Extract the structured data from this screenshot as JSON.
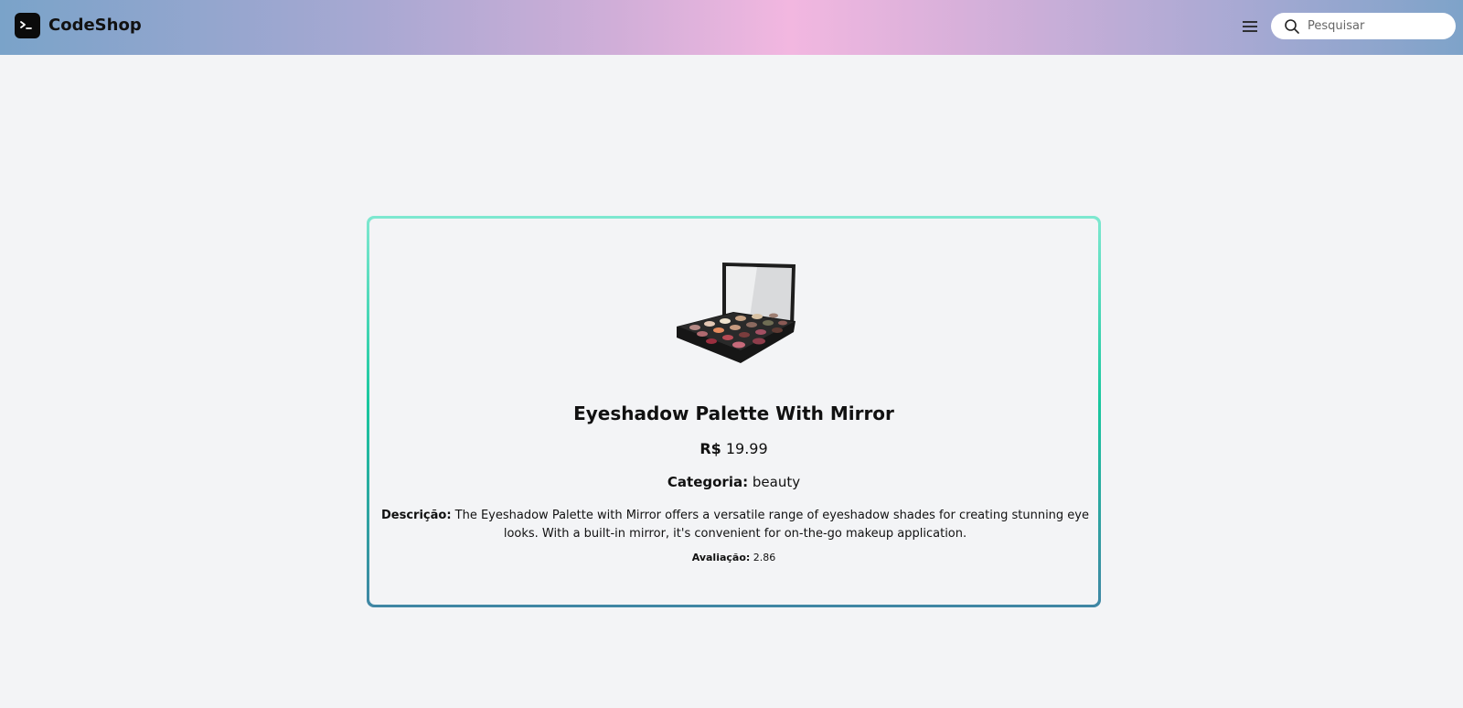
{
  "header": {
    "brand": "CodeShop",
    "menu_icon": "hamburger-menu-icon",
    "logo_icon": "terminal-icon",
    "search": {
      "placeholder": "Pesquisar",
      "value": "",
      "icon": "search-icon"
    },
    "gradient_colors": [
      "#7aa3c9",
      "#f2b7e0",
      "#7ea3c9"
    ]
  },
  "product": {
    "title": "Eyeshadow Palette With Mirror",
    "price_label": "R$",
    "price_value": "19.99",
    "category_label": "Categoria:",
    "category_value": "beauty",
    "description_label": "Descrição:",
    "description_value": "The Eyeshadow Palette with Mirror offers a versatile range of eyeshadow shades for creating stunning eye looks. With a built-in mirror, it's convenient for on-the-go makeup application.",
    "rating_label": "Avaliação:",
    "rating_value": "2.86",
    "image_alt": "eyeshadow-palette-image",
    "border_colors": [
      "#7ee8d0",
      "#18c79e",
      "#3f86a4"
    ]
  }
}
